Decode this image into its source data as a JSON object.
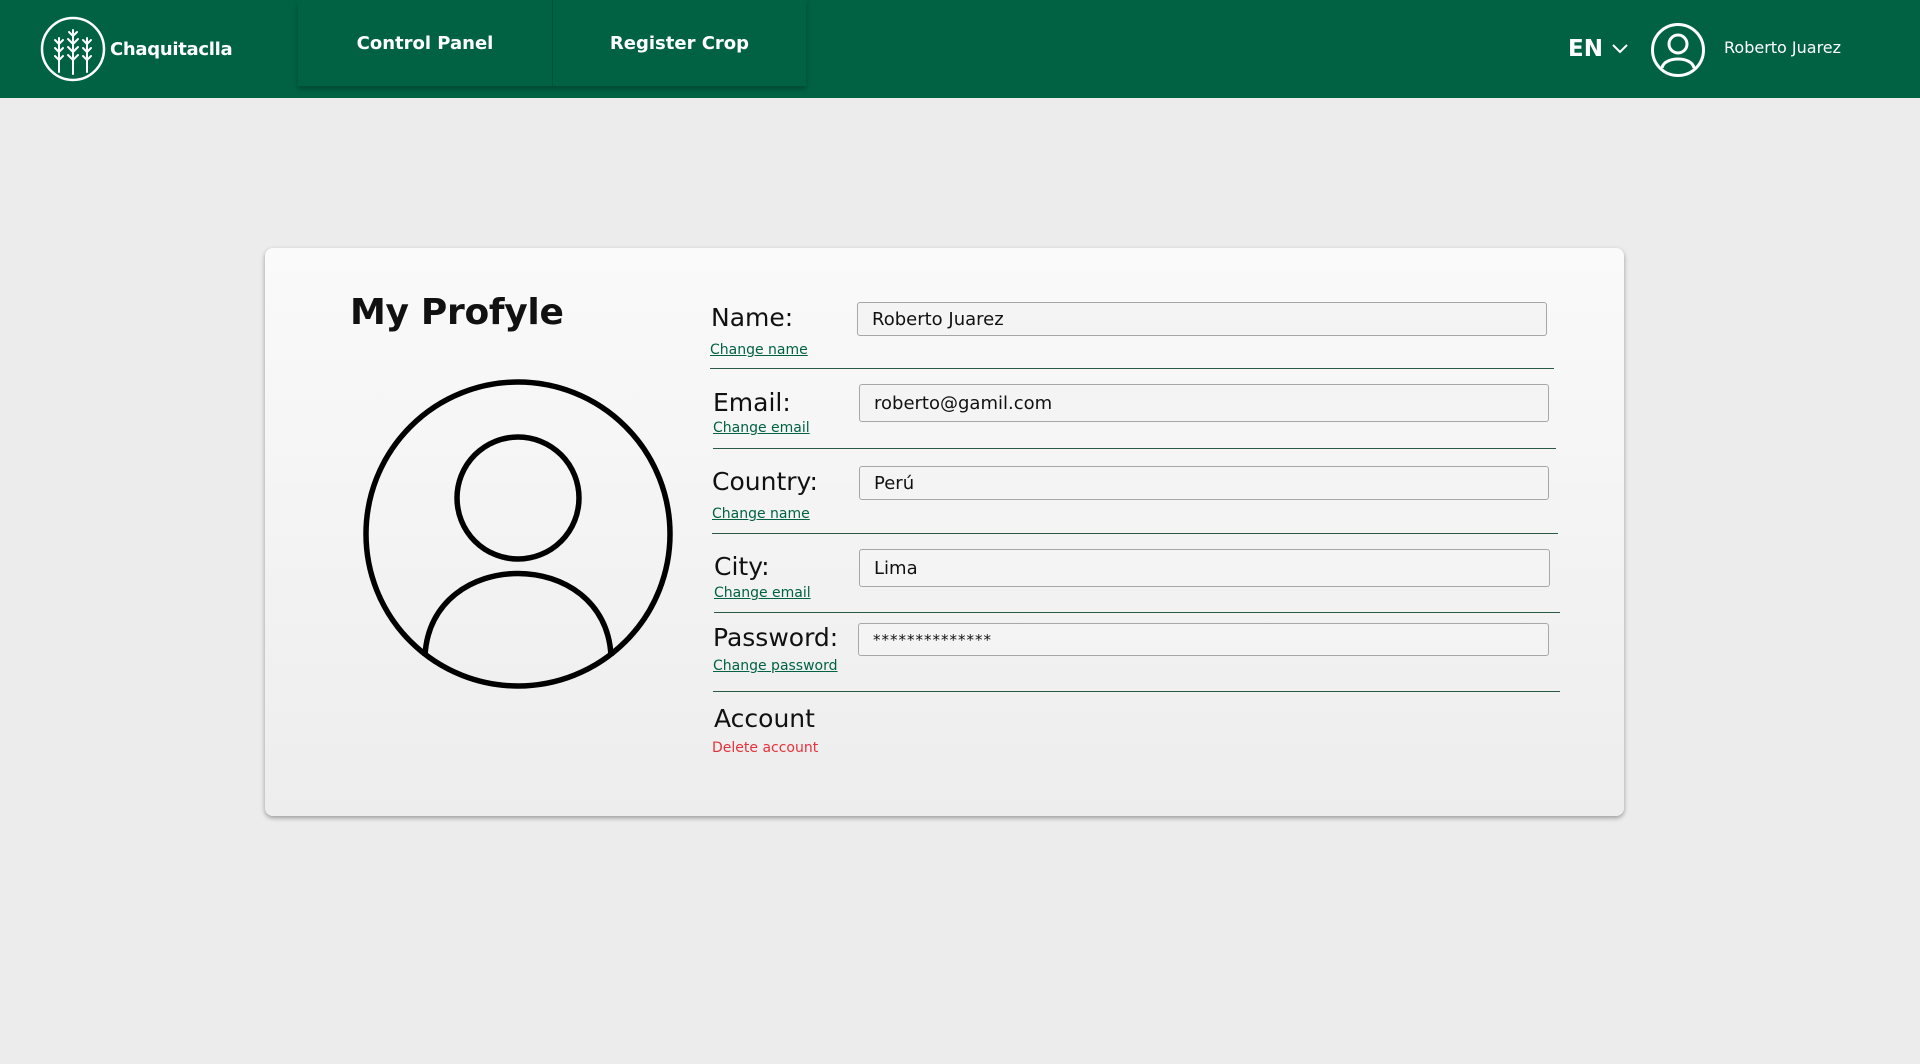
{
  "header": {
    "app_name": "Chaquitaclla",
    "nav": [
      {
        "label": "Control Panel"
      },
      {
        "label": "Register Crop"
      }
    ],
    "language": "EN",
    "user_name": "Roberto Juarez"
  },
  "profile": {
    "title": "My Profyle",
    "fields": {
      "name": {
        "label": "Name:",
        "value": "Roberto Juarez",
        "link": "Change name"
      },
      "email": {
        "label": "Email:",
        "value": "roberto@gamil.com",
        "link": "Change email"
      },
      "country": {
        "label": "Country:",
        "value": "Perú",
        "link": "Change name"
      },
      "city": {
        "label": "City:",
        "value": "Lima",
        "link": "Change email"
      },
      "password": {
        "label": "Password:",
        "value": "**************",
        "link": "Change password"
      }
    },
    "account": {
      "label": "Account",
      "delete_label": "Delete account"
    }
  },
  "colors": {
    "header_bg": "#016243",
    "link": "#016243",
    "danger": "#e5313a",
    "page_bg": "#ececec"
  }
}
